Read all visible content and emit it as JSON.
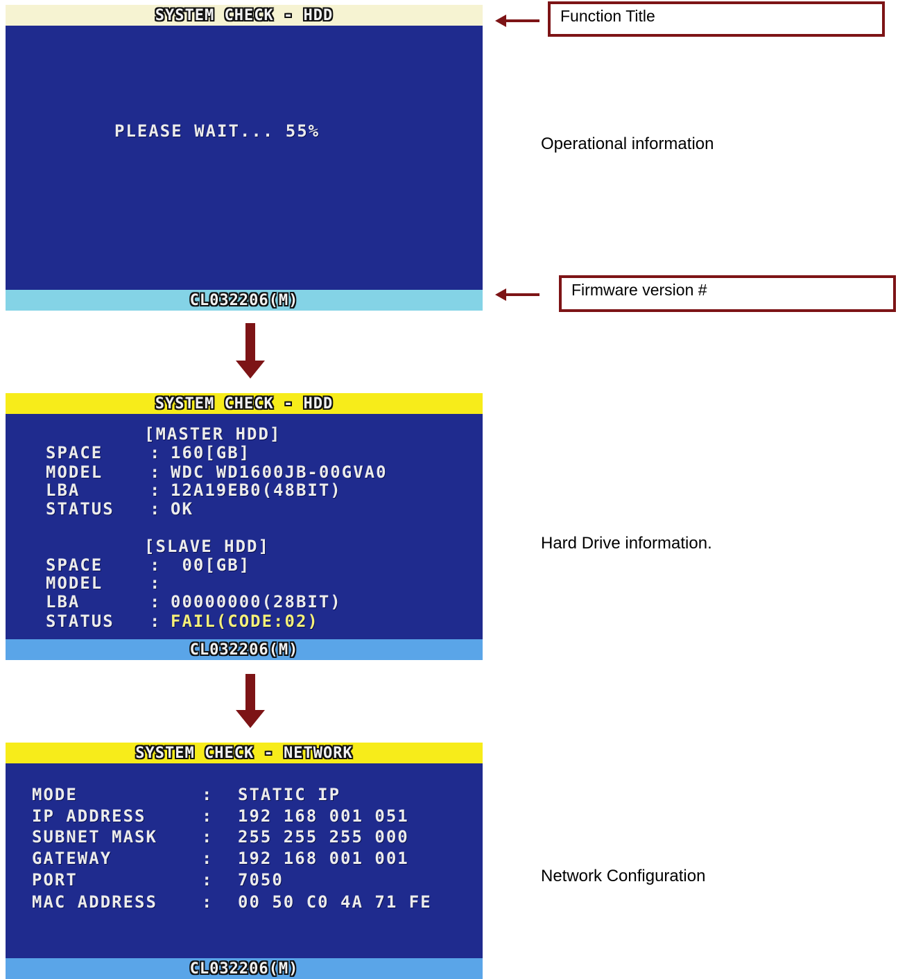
{
  "screen1": {
    "title": "SYSTEM CHECK - HDD",
    "message": "PLEASE WAIT... 55%",
    "firmware": "CL032206(M)"
  },
  "screen2": {
    "title": "SYSTEM CHECK - HDD",
    "master_header": "[MASTER HDD]",
    "master": [
      {
        "label": "SPACE",
        "value": "160[GB]"
      },
      {
        "label": "MODEL",
        "value": "WDC WD1600JB-00GVA0"
      },
      {
        "label": "LBA",
        "value": "12A19EB0(48BIT)"
      },
      {
        "label": "STATUS",
        "value": "OK"
      }
    ],
    "slave_header": "[SLAVE HDD]",
    "slave": [
      {
        "label": "SPACE",
        "value": " 00[GB]"
      },
      {
        "label": "MODEL",
        "value": ""
      },
      {
        "label": "LBA",
        "value": "00000000(28BIT)"
      },
      {
        "label": "STATUS",
        "value": "FAIL(CODE:02)"
      }
    ],
    "firmware": "CL032206(M)"
  },
  "screen3": {
    "title": "SYSTEM CHECK - NETWORK",
    "rows": [
      {
        "label": "MODE",
        "value": "STATIC IP"
      },
      {
        "label": "IP ADDRESS",
        "value": "192 168 001 051"
      },
      {
        "label": "SUBNET MASK",
        "value": "255 255 255 000"
      },
      {
        "label": "GATEWAY",
        "value": "192 168 001 001"
      },
      {
        "label": "PORT",
        "value": "7050"
      },
      {
        "label": "MAC ADDRESS",
        "value": "00 50 C0 4A 71 FE"
      }
    ],
    "firmware": "CL032206(M)"
  },
  "annotations": {
    "function_title": "Function Title",
    "operational_info": "Operational information",
    "firmware_version": "Firmware version #",
    "hard_drive_info": "Hard Drive information.",
    "network_config": "Network Configuration"
  },
  "colors": {
    "osd_background": "#1f2b8e",
    "arrow_accent": "#7d1416",
    "title_bar_yellow": "#f7ec1a",
    "footer_blue": "#5aa5e8",
    "fail_text": "#f5f07a"
  }
}
